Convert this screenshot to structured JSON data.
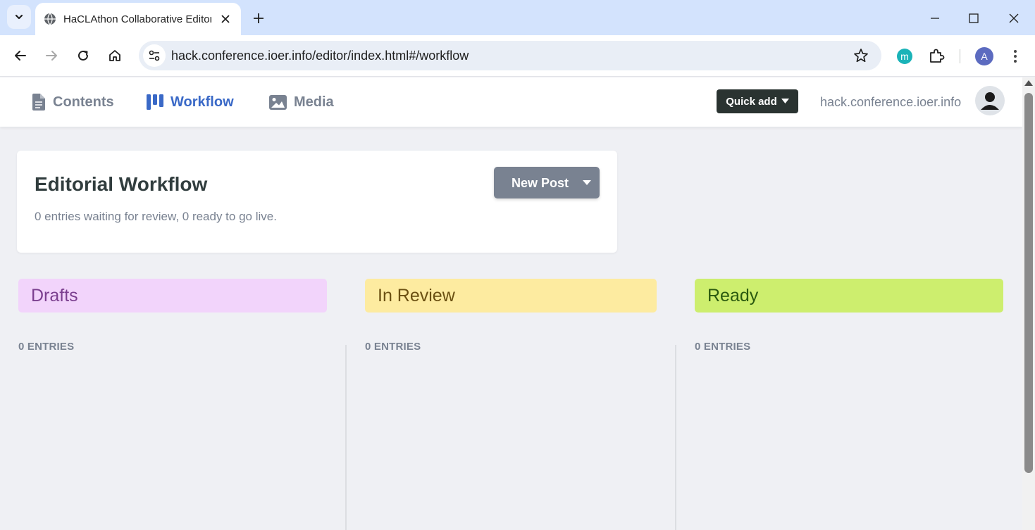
{
  "browser": {
    "tab_title": "HaCLAthon Collaborative Editor",
    "url": "hack.conference.ioer.info/editor/index.html#/workflow",
    "extension_label": "m",
    "profile_initial": "A"
  },
  "app": {
    "nav": [
      {
        "label": "Contents",
        "icon": "document-icon",
        "active": false
      },
      {
        "label": "Workflow",
        "icon": "kanban-icon",
        "active": true
      },
      {
        "label": "Media",
        "icon": "image-icon",
        "active": false
      }
    ],
    "quick_add_label": "Quick add",
    "site_link": "hack.conference.ioer.info"
  },
  "workflow": {
    "title": "Editorial Workflow",
    "summary": "0 entries waiting for review, 0 ready to go live.",
    "new_post_label": "New Post",
    "columns": [
      {
        "name": "Drafts",
        "count_label": "0 ENTRIES",
        "color": "#f2d4fb",
        "text_color": "#7b3f8f"
      },
      {
        "name": "In Review",
        "count_label": "0 ENTRIES",
        "color": "#fdeba0",
        "text_color": "#6b5012"
      },
      {
        "name": "Ready",
        "count_label": "0 ENTRIES",
        "color": "#cdee6e",
        "text_color": "#2b5a10"
      }
    ]
  },
  "colors": {
    "accent": "#3a69c7",
    "muted_text": "#798291",
    "quick_add_bg": "#2a3331",
    "page_bg": "#eff0f4"
  }
}
